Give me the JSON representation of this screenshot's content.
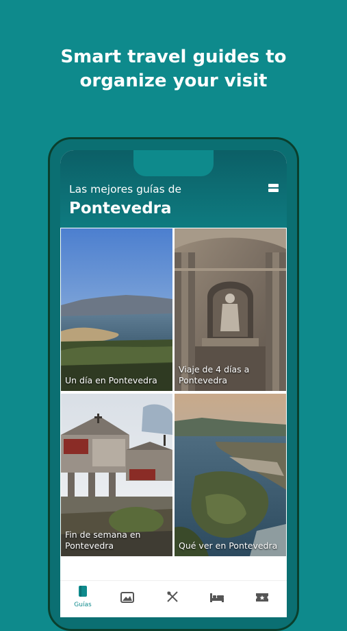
{
  "promo": {
    "headline_line1": "Smart travel guides to",
    "headline_line2": "organize your visit"
  },
  "app": {
    "header_subtitle": "Las mejores guías de",
    "header_title": "Pontevedra",
    "menu_icon": "menu-icon"
  },
  "guides": [
    {
      "label": "Un día en Pontevedra"
    },
    {
      "label": "Viaje de 4 días a Pontevedra"
    },
    {
      "label": "Fin de semana en Pontevedra"
    },
    {
      "label": "Qué ver en Pontevedra"
    }
  ],
  "nav": {
    "items": [
      {
        "icon": "book-icon",
        "label": "Guías",
        "active": true
      },
      {
        "icon": "image-icon",
        "label": ""
      },
      {
        "icon": "utensils-icon",
        "label": ""
      },
      {
        "icon": "bed-icon",
        "label": ""
      },
      {
        "icon": "ticket-icon",
        "label": ""
      }
    ]
  },
  "colors": {
    "background": "#0e8a8c",
    "phone_frame": "#0a3f2d",
    "accent": "#0e8a8c"
  }
}
